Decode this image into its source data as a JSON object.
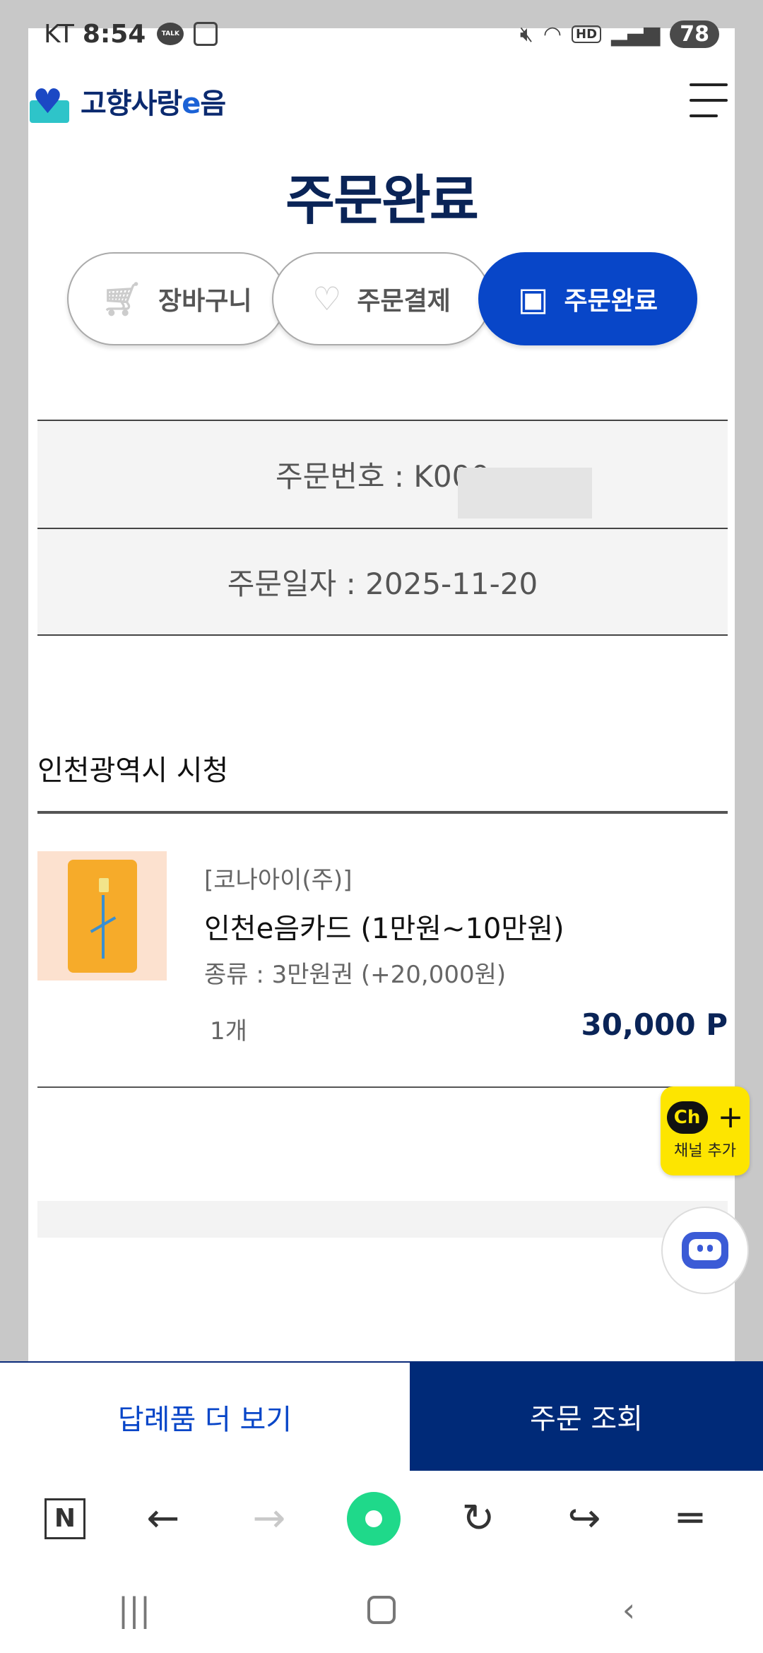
{
  "status_bar": {
    "carrier": "KT",
    "time": "8:54",
    "talk_badge": "TALK",
    "hd_badge": "HD",
    "battery": "78"
  },
  "header": {
    "logo_text_pre": "고향사랑",
    "logo_text_e": "e",
    "logo_text_post": "음",
    "page_title": "주문완료"
  },
  "steps": [
    {
      "label": "장바구니",
      "icon": "cart-icon",
      "active": false
    },
    {
      "label": "주문결제",
      "icon": "heart-circle-icon",
      "active": false
    },
    {
      "label": "주문완료",
      "icon": "save-icon",
      "active": true
    }
  ],
  "order": {
    "number_label": "주문번호 : K000",
    "date_label": "주문일자 : 2025-11-20"
  },
  "store": {
    "name": "인천광역시 시청"
  },
  "product": {
    "vendor": "[코나아이(주)]",
    "name": "인천e음카드 (1만원~10만원)",
    "option": "종류 : 3만원권 (+20,000원)",
    "quantity": "1개",
    "price": "30,000 P"
  },
  "floating": {
    "channel_logo": "Ch",
    "channel_plus": "+",
    "channel_label": "채널 추가"
  },
  "actions": {
    "more_gifts": "답례품 더 보기",
    "order_lookup": "주문 조회"
  },
  "browser_bar": {
    "naver_label": "N"
  },
  "colors": {
    "primary": "#0846c8",
    "navy": "#002a78",
    "title": "#0a2457",
    "kakao": "#fde500"
  }
}
